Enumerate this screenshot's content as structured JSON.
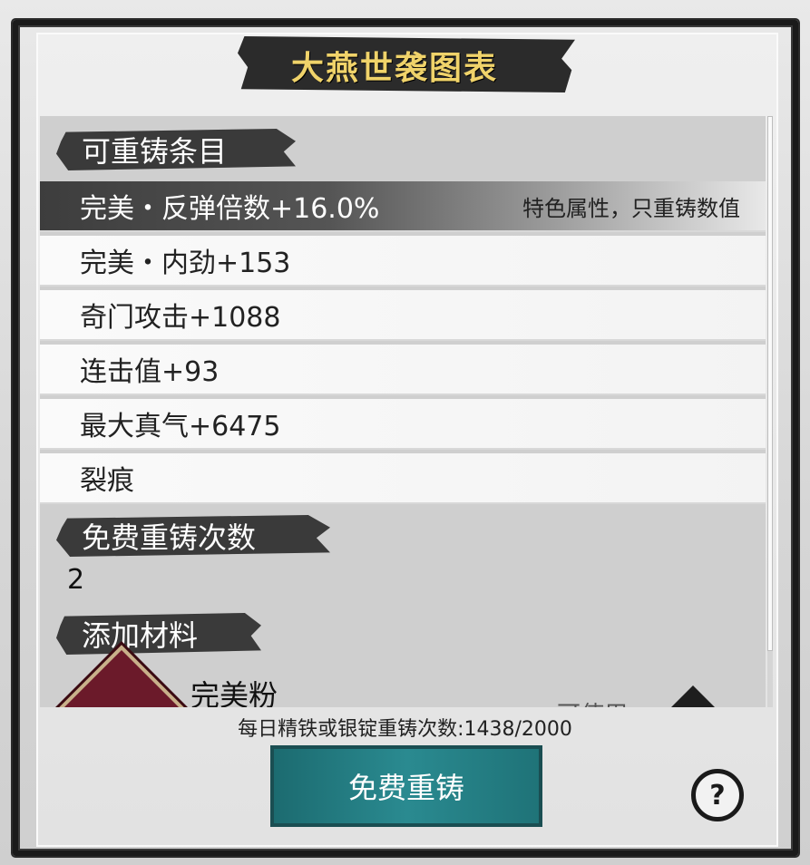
{
  "title": "大燕世袭图表",
  "sections": {
    "reforgeable_items": "可重铸条目",
    "free_reforge_count": "免费重铸次数",
    "add_material": "添加材料"
  },
  "items": [
    {
      "label": "完美・反弹倍数+16.0%",
      "hint": "特色属性，只重铸数值",
      "selected": true
    },
    {
      "label": "完美・内劲+153"
    },
    {
      "label": "奇门攻击+1088"
    },
    {
      "label": "连击值+93"
    },
    {
      "label": "最大真气+6475"
    },
    {
      "label": "裂痕"
    }
  ],
  "free_count": "2",
  "material": {
    "name": "完美粉",
    "partial_text": "可使用",
    "icon": "gem-icon"
  },
  "daily_text": "每日精铁或银锭重铸次数:1438/2000",
  "reforge_button": "免费重铸",
  "help_icon": "?",
  "colors": {
    "title": "#f0d36a",
    "button": "#2a8a90",
    "ink": "#2b2b2b"
  }
}
